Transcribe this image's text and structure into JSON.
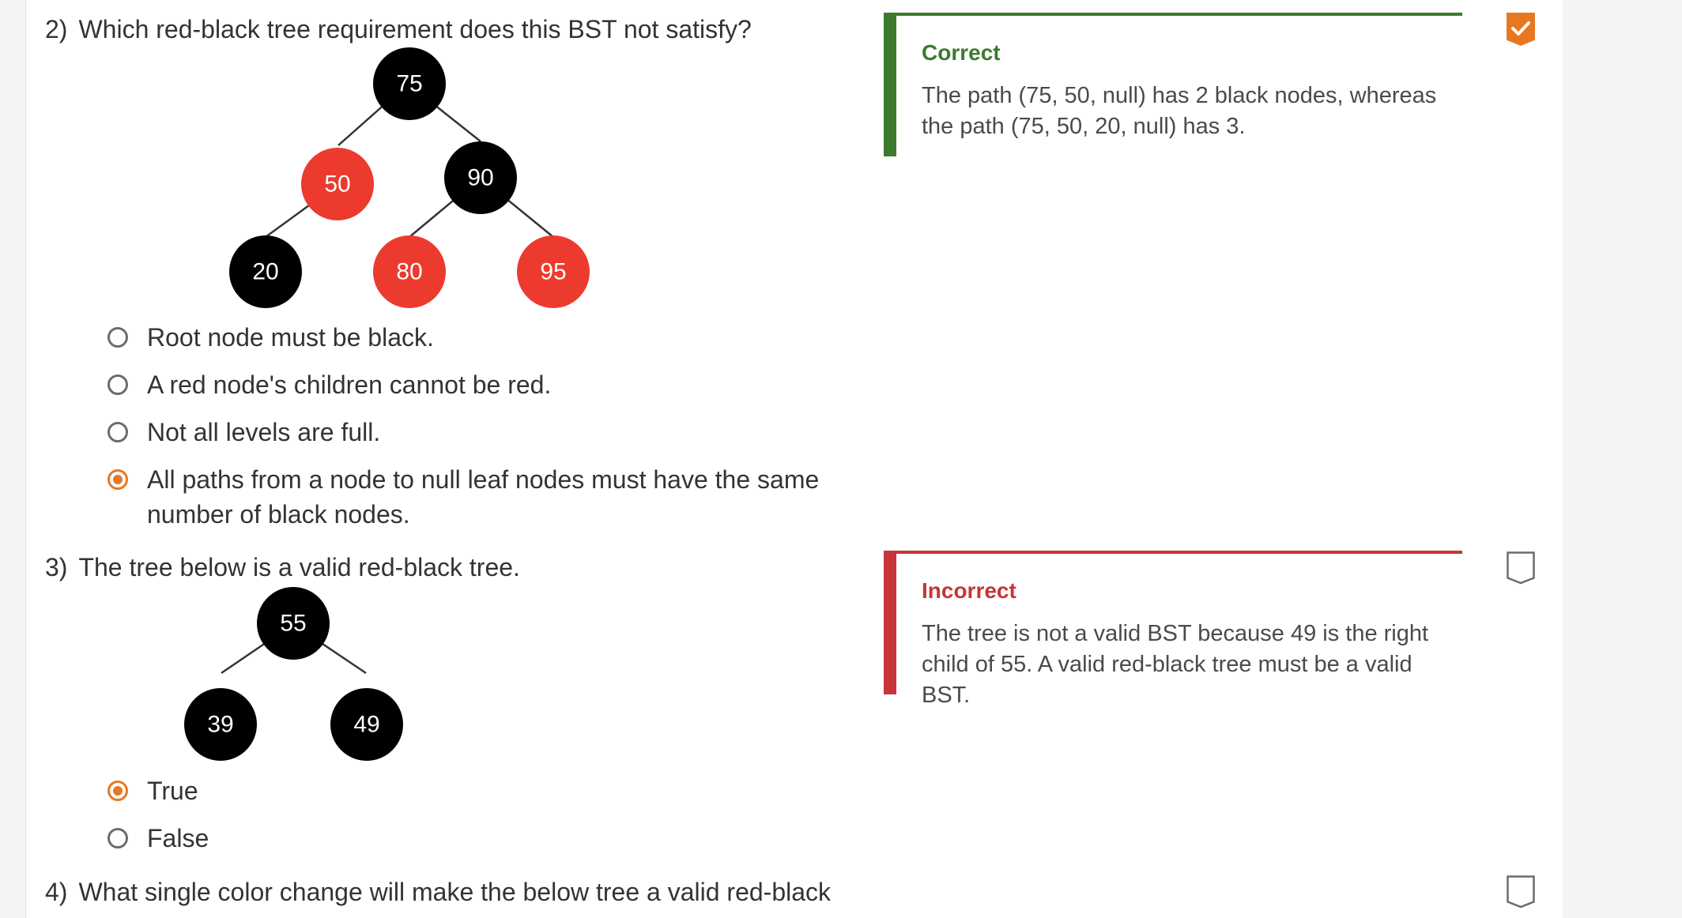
{
  "questions": [
    {
      "number": "2)",
      "text": "Which red-black tree requirement does this BST not satisfy?",
      "tree": {
        "nodes": [
          {
            "label": "75",
            "color": "black"
          },
          {
            "label": "50",
            "color": "red"
          },
          {
            "label": "90",
            "color": "black"
          },
          {
            "label": "20",
            "color": "black"
          },
          {
            "label": "80",
            "color": "red"
          },
          {
            "label": "95",
            "color": "red"
          }
        ]
      },
      "choices": [
        {
          "label": "Root node must be black.",
          "selected": false
        },
        {
          "label": "A red node's children cannot be red.",
          "selected": false
        },
        {
          "label": "Not all levels are full.",
          "selected": false
        },
        {
          "label_line1": "All paths from a node to null leaf nodes must have the same",
          "label_line2": "number of black nodes.",
          "selected": true
        }
      ],
      "feedback": {
        "status": "Correct",
        "text": "The path (75, 50, null) has 2 black nodes, whereas the path (75, 50, 20, null) has 3."
      },
      "flag": "checked-flag-icon"
    },
    {
      "number": "3)",
      "text": "The tree below is a valid red-black tree.",
      "tree": {
        "nodes": [
          {
            "label": "55",
            "color": "black"
          },
          {
            "label": "39",
            "color": "black"
          },
          {
            "label": "49",
            "color": "black"
          }
        ]
      },
      "choices": [
        {
          "label": "True",
          "selected": true
        },
        {
          "label": "False",
          "selected": false
        }
      ],
      "feedback": {
        "status": "Incorrect",
        "text": "The tree is not a valid BST because 49 is the right child of 55. A valid red-black tree must be a valid BST."
      },
      "flag": "empty-flag-icon"
    },
    {
      "number": "4)",
      "text": "What single color change will make the below tree a valid red-black",
      "flag": "empty-flag-icon"
    }
  ],
  "colors": {
    "node_black": "#000000",
    "node_red": "#ec3b2e",
    "accent_orange": "#e87722",
    "correct_green": "#3d7a2e",
    "incorrect_red": "#c8343a"
  }
}
